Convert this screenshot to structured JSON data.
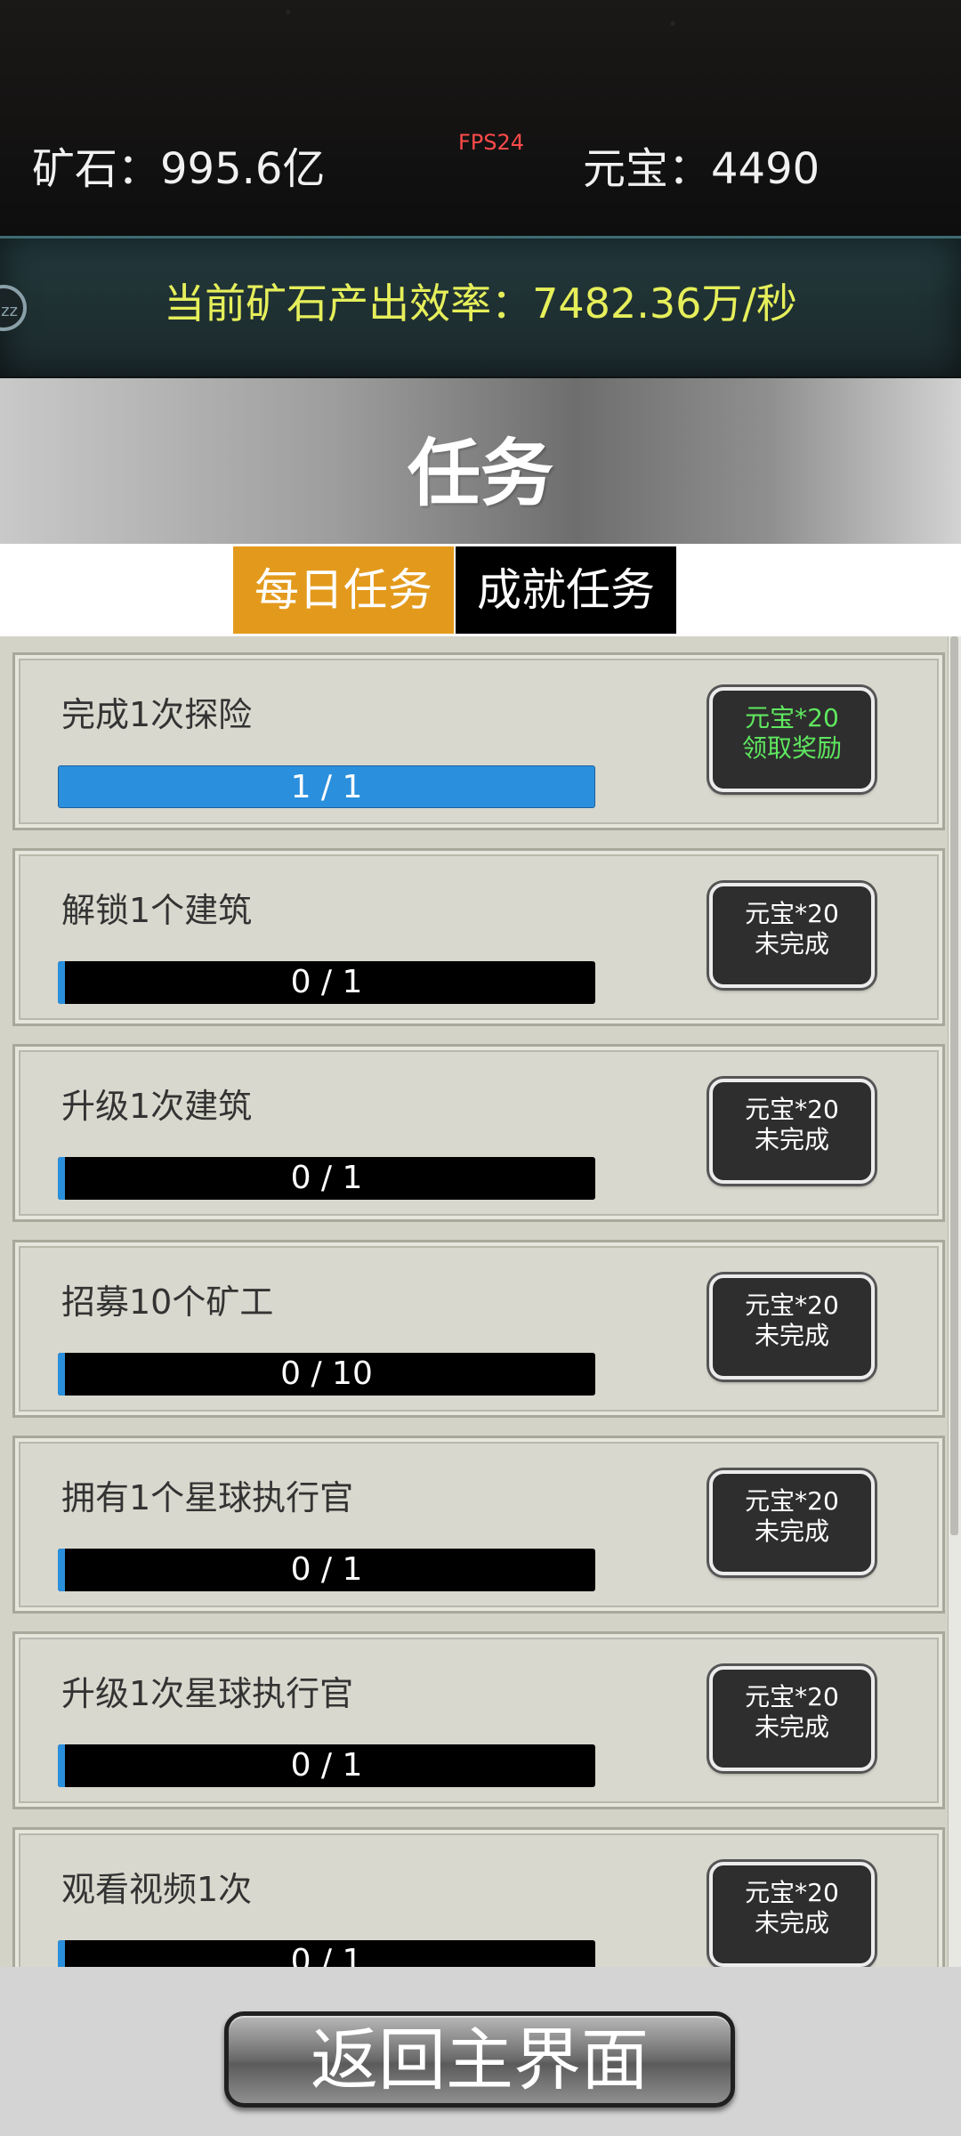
{
  "status_bar": {
    "ore": "矿石：995.6亿",
    "fps": "FPS24",
    "gold": "元宝：4490"
  },
  "rate": {
    "text": "当前矿石产出效率：7482.36万/秒",
    "side_icon": "zz-sleep-icon",
    "side_text": "zz"
  },
  "panel": {
    "title": "任务"
  },
  "tabs": [
    {
      "label": "每日任务",
      "active": true
    },
    {
      "label": "成就任务",
      "active": false
    }
  ],
  "tasks": [
    {
      "name": "完成1次探险",
      "progress": "1 / 1",
      "fraction": 1.0,
      "reward": "元宝*20",
      "status": "领取奖励",
      "done": true
    },
    {
      "name": "解锁1个建筑",
      "progress": "0 / 1",
      "fraction": 0.0,
      "reward": "元宝*20",
      "status": "未完成",
      "done": false
    },
    {
      "name": "升级1次建筑",
      "progress": "0 / 1",
      "fraction": 0.0,
      "reward": "元宝*20",
      "status": "未完成",
      "done": false
    },
    {
      "name": "招募10个矿工",
      "progress": "0 / 10",
      "fraction": 0.0,
      "reward": "元宝*20",
      "status": "未完成",
      "done": false
    },
    {
      "name": "拥有1个星球执行官",
      "progress": "0 / 1",
      "fraction": 0.0,
      "reward": "元宝*20",
      "status": "未完成",
      "done": false
    },
    {
      "name": "升级1次星球执行官",
      "progress": "0 / 1",
      "fraction": 0.0,
      "reward": "元宝*20",
      "status": "未完成",
      "done": false
    },
    {
      "name": "观看视频1次",
      "progress": "0 / 1",
      "fraction": 0.0,
      "reward": "元宝*20",
      "status": "未完成",
      "done": false
    }
  ],
  "footer": {
    "return_label": "返回主界面"
  },
  "colors": {
    "rate_text": "#e6ef5a",
    "active_tab": "#e39a1c",
    "progress_fill": "#2a8fdc",
    "claim_text": "#5fe85f",
    "fps": "#ff4a4a"
  }
}
